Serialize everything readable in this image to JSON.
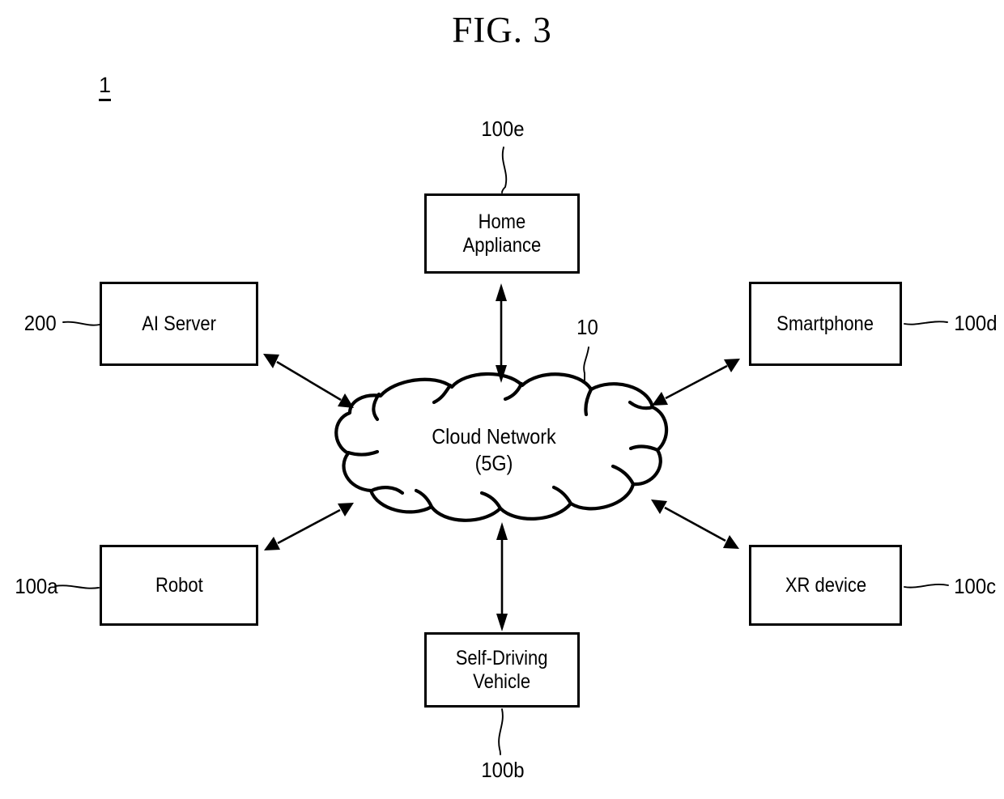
{
  "figure": {
    "title": "FIG. 3",
    "system_id": "1"
  },
  "cloud": {
    "name": "cloud-network",
    "label": "Cloud Network\n(5G)",
    "ref": "10"
  },
  "nodes": [
    {
      "id": "home-appliance",
      "label": "Home\nAppliance",
      "ref": "100e",
      "position": "top"
    },
    {
      "id": "ai-server",
      "label": "AI Server",
      "ref": "200",
      "position": "top-left"
    },
    {
      "id": "smartphone",
      "label": "Smartphone",
      "ref": "100d",
      "position": "top-right"
    },
    {
      "id": "robot",
      "label": "Robot",
      "ref": "100a",
      "position": "bottom-left"
    },
    {
      "id": "xr-device",
      "label": "XR device",
      "ref": "100c",
      "position": "bottom-right"
    },
    {
      "id": "self-driving",
      "label": "Self-Driving\nVehicle",
      "ref": "100b",
      "position": "bottom"
    }
  ],
  "connections": [
    {
      "from": "home-appliance",
      "to": "cloud-network",
      "type": "bidirectional"
    },
    {
      "from": "ai-server",
      "to": "cloud-network",
      "type": "bidirectional"
    },
    {
      "from": "smartphone",
      "to": "cloud-network",
      "type": "bidirectional"
    },
    {
      "from": "robot",
      "to": "cloud-network",
      "type": "bidirectional"
    },
    {
      "from": "xr-device",
      "to": "cloud-network",
      "type": "bidirectional"
    },
    {
      "from": "self-driving",
      "to": "cloud-network",
      "type": "bidirectional"
    }
  ],
  "colors": {
    "ink": "#000000",
    "paper": "#ffffff"
  }
}
